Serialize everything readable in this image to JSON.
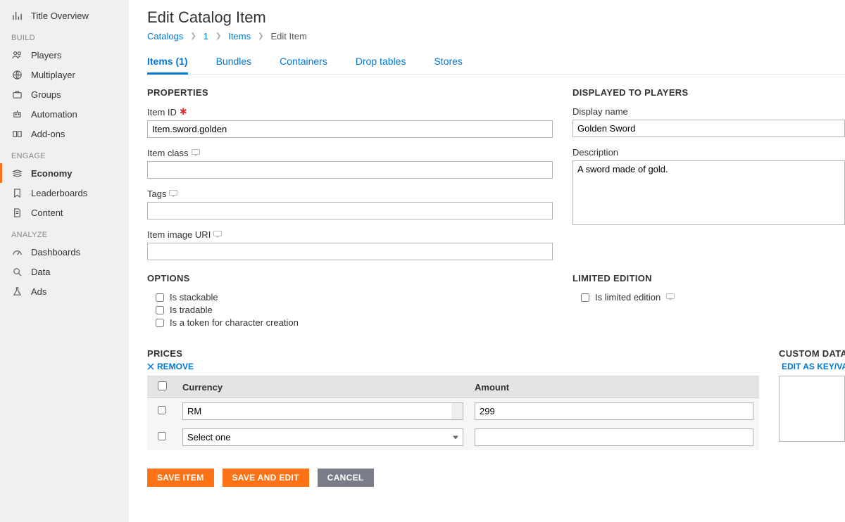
{
  "sidebar": {
    "top": {
      "label": "Title Overview"
    },
    "groups": {
      "build": {
        "title": "BUILD",
        "items": [
          "Players",
          "Multiplayer",
          "Groups",
          "Automation",
          "Add-ons"
        ]
      },
      "engage": {
        "title": "ENGAGE",
        "items": [
          "Economy",
          "Leaderboards",
          "Content"
        ],
        "active": 0
      },
      "analyze": {
        "title": "ANALYZE",
        "items": [
          "Dashboards",
          "Data",
          "Ads"
        ]
      }
    }
  },
  "page": {
    "title": "Edit Catalog Item",
    "breadcrumb": {
      "a": "Catalogs",
      "b": "1",
      "c": "Items",
      "d": "Edit Item"
    }
  },
  "tabs": [
    "Items (1)",
    "Bundles",
    "Containers",
    "Drop tables",
    "Stores"
  ],
  "properties": {
    "heading": "PROPERTIES",
    "itemId": {
      "label": "Item ID",
      "value": "Item.sword.golden"
    },
    "itemClass": {
      "label": "Item class",
      "value": ""
    },
    "tags": {
      "label": "Tags",
      "value": ""
    },
    "imageUri": {
      "label": "Item image URI",
      "value": ""
    }
  },
  "displayed": {
    "heading": "DISPLAYED TO PLAYERS",
    "displayName": {
      "label": "Display name",
      "value": "Golden Sword"
    },
    "description": {
      "label": "Description",
      "value": "A sword made of gold."
    }
  },
  "options": {
    "heading": "OPTIONS",
    "stackable": "Is stackable",
    "tradable": "Is tradable",
    "token": "Is a token for character creation"
  },
  "limited": {
    "heading": "LIMITED EDITION",
    "isLimited": "Is limited edition"
  },
  "prices": {
    "heading": "PRICES",
    "remove": "REMOVE",
    "cols": {
      "currency": "Currency",
      "amount": "Amount"
    },
    "rows": [
      {
        "currency": "RM",
        "amount": "299"
      },
      {
        "currency": "Select one",
        "amount": ""
      }
    ]
  },
  "customData": {
    "heading": "CUSTOM DATA",
    "editLink": "EDIT AS KEY/VALUE"
  },
  "actions": {
    "save": "SAVE ITEM",
    "saveEdit": "SAVE AND EDIT",
    "cancel": "CANCEL"
  }
}
